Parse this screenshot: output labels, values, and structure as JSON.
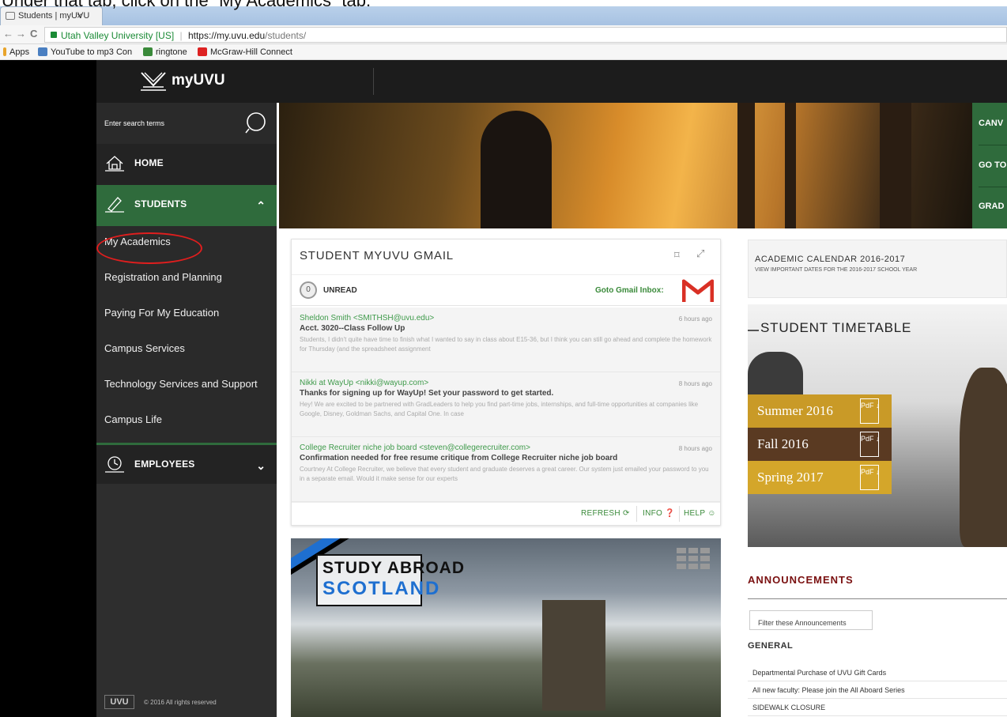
{
  "instruction": "Under that tab, click on the “My Academics” tab.",
  "browser": {
    "tab_title": "Students | myUVU",
    "tab_close": "×",
    "back": "←",
    "forward": "→",
    "reload": "C",
    "org": "Utah Valley University [US]",
    "separator": "|",
    "url_host": "https://my.uvu.edu",
    "url_path": "/students/",
    "bookmarks": [
      "Apps",
      "YouTube to mp3 Con",
      "ringtone",
      "McGraw-Hill Connect"
    ]
  },
  "header": {
    "logo_text": "myUVU"
  },
  "sidebar": {
    "search_placeholder": "Enter search terms",
    "home_label": "HOME",
    "students_label": "STUDENTS",
    "students_chevron": "⌃",
    "employees_label": "EMPLOYEES",
    "employees_chevron": "⌄",
    "students_submenu": [
      "My Academics",
      "Registration and Planning",
      "Paying For My Education",
      "Campus Services",
      "Technology Services and Support",
      "Campus Life"
    ],
    "footer_mark": "UVU",
    "footer_text": "© 2016 All rights reserved"
  },
  "hero_links": [
    "CANV",
    "GO TO",
    "GRAD"
  ],
  "gmail": {
    "title": "STUDENT MYUVU GMAIL",
    "bookmark_icon": "⌑",
    "expand_icon": "⤢",
    "unread_count": "0",
    "unread_label": "UNREAD",
    "goto_label": "Goto Gmail Inbox:",
    "messages": [
      {
        "from": "Sheldon Smith <SMITHSH@uvu.edu>",
        "time": "6 hours ago",
        "subject": "Acct. 3020--Class Follow Up",
        "preview": "Students, I didn't quite have time to finish what I wanted to say in class about E15-36, but I think you can still go ahead and complete the homework for Thursday (and the spreadsheet assignment"
      },
      {
        "from": "Nikki at WayUp <nikki@wayup.com>",
        "time": "8 hours ago",
        "subject": "Thanks for signing up for WayUp! Set your password to get started.",
        "preview": "Hey! We are excited to be partnered with GradLeaders to help you find part-time jobs, internships, and full-time opportunities at companies like Google, Disney, Goldman Sachs, and Capital One. In case"
      },
      {
        "from": "College Recruiter niche job board <steven@collegerecruiter.com>",
        "time": "8 hours ago",
        "subject": "Confirmation needed for free resume critique from College Recruiter niche job board",
        "preview": "Courtney At College Recruiter, we believe that every student and graduate deserves a great career. Our system just emailed your password to you in a separate email. Would it make sense for our experts"
      }
    ],
    "actions": [
      "REFRESH ⟳",
      "INFO ❓",
      "HELP ☺"
    ]
  },
  "study_abroad": {
    "line1": "STUDY ABROAD",
    "line2": "SCOTLAND"
  },
  "academic_calendar": {
    "title": "ACADEMIC CALENDAR 2016-2017",
    "subtitle": "VIEW IMPORTANT DATES FOR THE 2016-2017 SCHOOL YEAR"
  },
  "timetable": {
    "title": "STUDENT TIMETABLE",
    "pdf_label": "PdF ↓",
    "terms": [
      {
        "label": "Summer 2016",
        "color": "#c99a27"
      },
      {
        "label": "Fall 2016",
        "color": "#5a3a22"
      },
      {
        "label": "Spring 2017",
        "color": "#d4a62a"
      }
    ]
  },
  "announcements": {
    "title": "ANNOUNCEMENTS",
    "filter_label": "Filter these Announcements",
    "group": "GENERAL",
    "items": [
      "Departmental Purchase of UVU Gift Cards",
      "All new faculty: Please join the All Aboard Series",
      "SIDEWALK CLOSURE"
    ]
  },
  "colors": {
    "uvu_green": "#2f6b3c",
    "annotation_red": "#e01e1e",
    "dark": "#1c1c1c"
  }
}
